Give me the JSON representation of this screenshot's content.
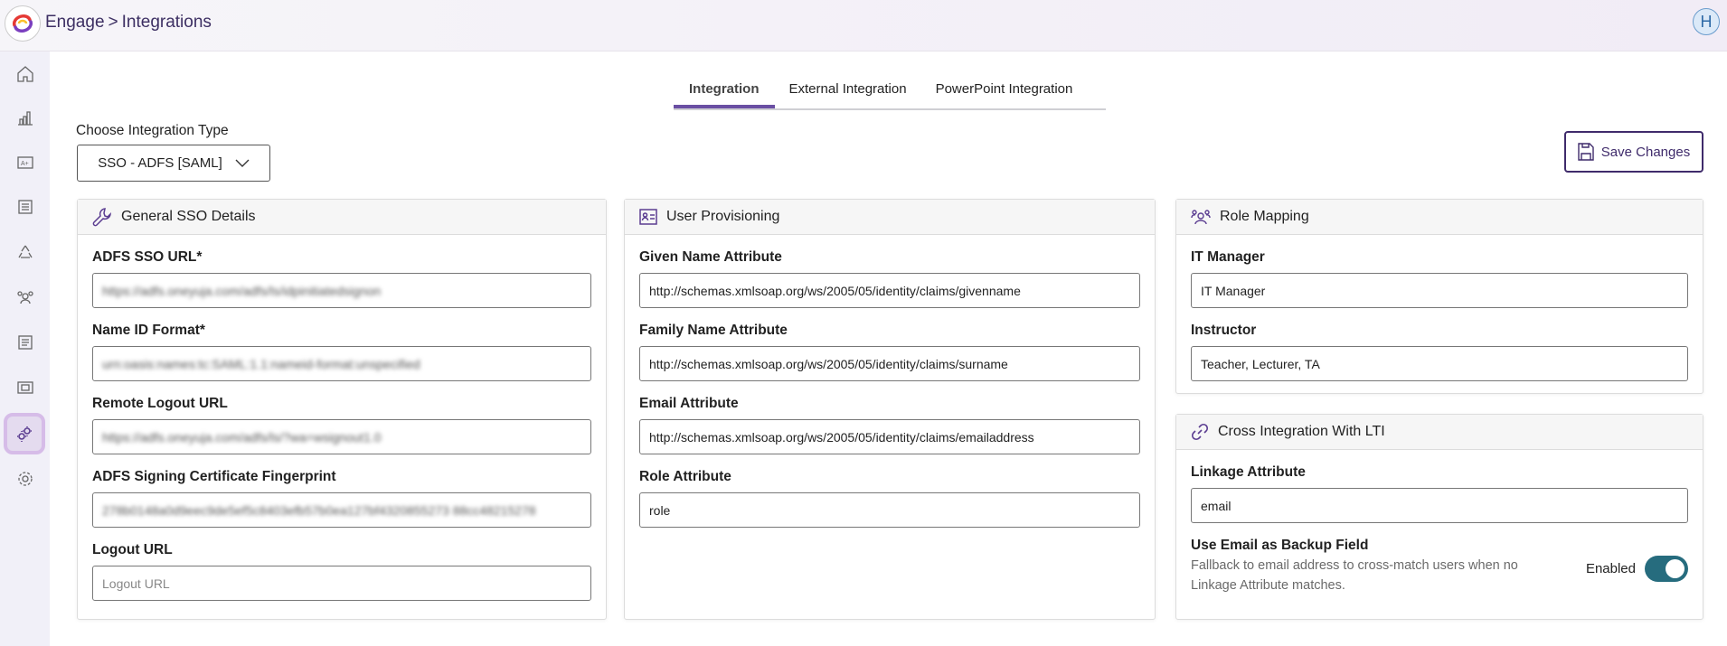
{
  "header": {
    "app": "Engage",
    "separator": ">",
    "page": "Integrations",
    "avatar_initial": "H"
  },
  "sidebar": {
    "items": [
      {
        "icon": "home-icon"
      },
      {
        "icon": "bar-chart-icon"
      },
      {
        "icon": "grade-icon"
      },
      {
        "icon": "report-icon"
      },
      {
        "icon": "recycle-icon"
      },
      {
        "icon": "users-icon"
      },
      {
        "icon": "list-icon"
      },
      {
        "icon": "gallery-icon"
      },
      {
        "icon": "integration-gears-icon",
        "active": true
      },
      {
        "icon": "settings-icon"
      }
    ]
  },
  "tabs": [
    {
      "label": "Integration",
      "active": true
    },
    {
      "label": "External Integration"
    },
    {
      "label": "PowerPoint Integration"
    }
  ],
  "integration_type": {
    "label": "Choose Integration Type",
    "value": "SSO - ADFS [SAML]"
  },
  "save_label": "Save Changes",
  "general": {
    "title": "General SSO Details",
    "fields": [
      {
        "label": "ADFS SSO URL*",
        "value": "https://adfs.oneyuja.com/adfs/ls/idpinitiatedsignon"
      },
      {
        "label": "Name ID Format*",
        "value": "urn:oasis:names:tc:SAML:1.1:nameid-format:unspecified"
      },
      {
        "label": "Remote Logout URL",
        "value": "https://adfs.oneyuja.com/adfs/ls/?wa=wsignout1.0"
      },
      {
        "label": "ADFS Signing Certificate Fingerprint",
        "value": "278b0148a0d9eec9de5ef5c8403efb57b0ea127bf4320855273 88cc48215278"
      },
      {
        "label": "Logout URL",
        "placeholder": "Logout URL"
      }
    ]
  },
  "provisioning": {
    "title": "User Provisioning",
    "fields": [
      {
        "label": "Given Name Attribute",
        "value": "http://schemas.xmlsoap.org/ws/2005/05/identity/claims/givenname"
      },
      {
        "label": "Family Name Attribute",
        "value": "http://schemas.xmlsoap.org/ws/2005/05/identity/claims/surname"
      },
      {
        "label": "Email Attribute",
        "value": "http://schemas.xmlsoap.org/ws/2005/05/identity/claims/emailaddress"
      },
      {
        "label": "Role Attribute",
        "value": "role"
      }
    ]
  },
  "roles": {
    "title": "Role Mapping",
    "fields": [
      {
        "label": "IT Manager",
        "value": "IT Manager"
      },
      {
        "label": "Instructor",
        "value": "Teacher, Lecturer, TA"
      }
    ]
  },
  "cross": {
    "title": "Cross Integration With LTI",
    "linkage_label": "Linkage Attribute",
    "linkage_value": "email",
    "backup_label": "Use Email as Backup Field",
    "backup_desc": "Fallback to email address to cross-match users when no Linkage Attribute matches.",
    "toggle_label": "Enabled",
    "toggle_on": true
  },
  "colors": {
    "accent": "#6a4fa3",
    "toggle": "#266c7e",
    "save_border": "#3f2b6b"
  }
}
